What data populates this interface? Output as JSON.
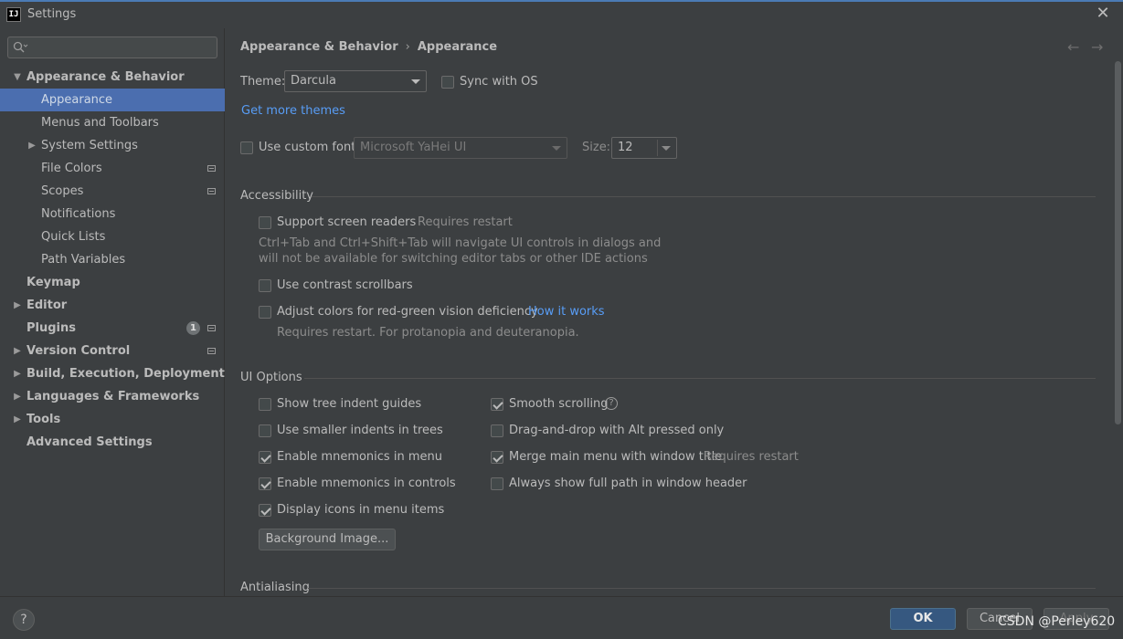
{
  "window": {
    "title": "Settings",
    "app_icon_text": "IJ"
  },
  "sidebar": {
    "search_placeholder": "",
    "items": [
      {
        "label": "Appearance & Behavior"
      },
      {
        "label": "Appearance"
      },
      {
        "label": "Menus and Toolbars"
      },
      {
        "label": "System Settings"
      },
      {
        "label": "File Colors"
      },
      {
        "label": "Scopes"
      },
      {
        "label": "Notifications"
      },
      {
        "label": "Quick Lists"
      },
      {
        "label": "Path Variables"
      },
      {
        "label": "Keymap"
      },
      {
        "label": "Editor"
      },
      {
        "label": "Plugins",
        "badge": "1"
      },
      {
        "label": "Version Control"
      },
      {
        "label": "Build, Execution, Deployment"
      },
      {
        "label": "Languages & Frameworks"
      },
      {
        "label": "Tools"
      },
      {
        "label": "Advanced Settings"
      }
    ]
  },
  "breadcrumb": {
    "parent": "Appearance & Behavior",
    "sep": "›",
    "current": "Appearance"
  },
  "nav": {
    "back": "←",
    "forward": "→"
  },
  "theme": {
    "label": "Theme:",
    "value": "Darcula",
    "sync_label": "Sync with OS",
    "sync_checked": false,
    "more_link": "Get more themes"
  },
  "font": {
    "custom_label": "Use custom font:",
    "custom_checked": false,
    "font_value": "Microsoft YaHei UI",
    "size_label": "Size:",
    "size_value": "12"
  },
  "accessibility": {
    "title": "Accessibility",
    "screen_readers": {
      "label": "Support screen readers",
      "checked": false,
      "note": "Requires restart"
    },
    "screen_readers_desc_1": "Ctrl+Tab and Ctrl+Shift+Tab will navigate UI controls in dialogs and",
    "screen_readers_desc_2": "will not be available for switching editor tabs or other IDE actions",
    "contrast_scrollbars": {
      "label": "Use contrast scrollbars",
      "checked": false
    },
    "red_green": {
      "label": "Adjust colors for red-green vision deficiency",
      "checked": false,
      "link": "How it works"
    },
    "red_green_desc": "Requires restart. For protanopia and deuteranopia."
  },
  "ui_options": {
    "title": "UI Options",
    "tree_indent": {
      "label": "Show tree indent guides",
      "checked": false
    },
    "smaller_indents": {
      "label": "Use smaller indents in trees",
      "checked": false
    },
    "mnemonics_menu": {
      "label": "Enable mnemonics in menu",
      "checked": true
    },
    "mnemonics_controls": {
      "label": "Enable mnemonics in controls",
      "checked": true
    },
    "icons_menu": {
      "label": "Display icons in menu items",
      "checked": true
    },
    "smooth_scrolling": {
      "label": "Smooth scrolling",
      "checked": true,
      "help": "?"
    },
    "dnd_alt": {
      "label": "Drag-and-drop with Alt pressed only",
      "checked": false
    },
    "merge_menu": {
      "label": "Merge main menu with window title",
      "checked": true,
      "note": "Requires restart"
    },
    "full_path": {
      "label": "Always show full path in window header",
      "checked": false
    },
    "background_button": "Background Image..."
  },
  "antialiasing": {
    "title": "Antialiasing"
  },
  "footer": {
    "help": "?",
    "ok": "OK",
    "cancel": "Cancel",
    "apply": "Apply",
    "watermark": "CSDN @Perley620"
  },
  "colors": {
    "selection": "#4b6eaf",
    "link": "#589df6",
    "primary_button": "#365880",
    "background": "#3c3f41"
  }
}
